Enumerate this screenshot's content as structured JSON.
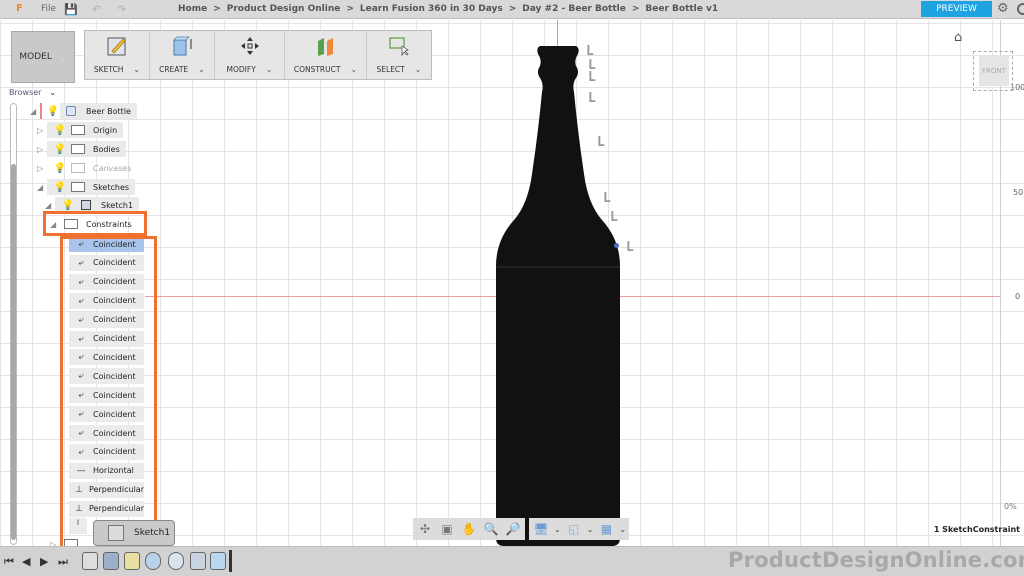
{
  "topbar": {
    "logo": "F",
    "file_menu": "File",
    "breadcrumb": [
      "Home",
      "Product Design Online",
      "Learn Fusion 360 in 30 Days",
      "Day #2 - Beer Bottle",
      "Beer Bottle v1"
    ],
    "breadcrumb_sep": ">",
    "preview_button": "PREVIEW"
  },
  "workspace": {
    "model_button": "MODEL",
    "tools": [
      {
        "label": "SKETCH",
        "icon": "sketch-icon"
      },
      {
        "label": "CREATE",
        "icon": "create-box-icon"
      },
      {
        "label": "MODIFY",
        "icon": "move-arrows-icon"
      },
      {
        "label": "CONSTRUCT",
        "icon": "construct-plane-icon"
      },
      {
        "label": "SELECT",
        "icon": "select-cursor-icon"
      }
    ]
  },
  "browser": {
    "title": "Browser",
    "root": "Beer Bottle",
    "folders": [
      {
        "label": "Origin",
        "muted": false
      },
      {
        "label": "Bodies",
        "muted": false
      },
      {
        "label": "Canvases",
        "muted": true
      },
      {
        "label": "Sketches",
        "muted": false
      }
    ],
    "sketch": "Sketch1",
    "constraints_folder": "Constraints",
    "constraints": [
      "Coincident",
      "Coincident",
      "Coincident",
      "Coincident",
      "Coincident",
      "Coincident",
      "Coincident",
      "Coincident",
      "Coincident",
      "Coincident",
      "Coincident",
      "Coincident",
      "Horizontal",
      "Perpendicular",
      "Perpendicular"
    ],
    "selected_index": 0
  },
  "tooltip": {
    "label": "Sketch1"
  },
  "viewport": {
    "viewcube_face": "FRONT",
    "ruler": {
      "top": "100",
      "mid": "50",
      "zero": "0"
    },
    "zoom_pct": "0%"
  },
  "status": {
    "selection": "1 SketchConstraint"
  },
  "watermark": "ProductDesignOnline.com"
}
